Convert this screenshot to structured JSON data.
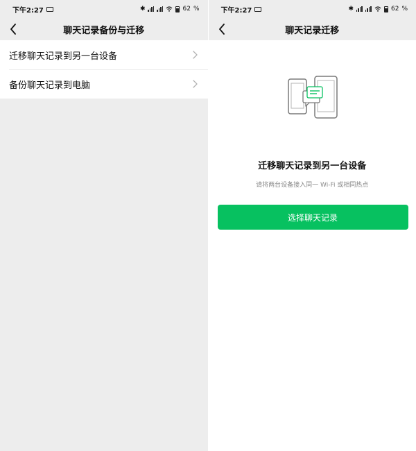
{
  "colors": {
    "brand_green": "#07c160",
    "background_gray": "#ededed",
    "text_primary": "#111111",
    "text_secondary": "#8a8a8a"
  },
  "status_bar": {
    "time": "下午2:27",
    "battery": "62",
    "battery_unit": "%",
    "icons": [
      "message-icon",
      "bluetooth-icon",
      "signal-icon",
      "signal-icon",
      "wifi-icon",
      "battery-icon"
    ]
  },
  "left_screen": {
    "nav": {
      "title": "聊天记录备份与迁移",
      "back_icon": "chevron-left-icon"
    },
    "items": [
      {
        "label": "迁移聊天记录到另一台设备",
        "icon": "chevron-right-icon"
      },
      {
        "label": "备份聊天记录到电脑",
        "icon": "chevron-right-icon"
      }
    ]
  },
  "right_screen": {
    "nav": {
      "title": "聊天记录迁移",
      "back_icon": "chevron-left-icon"
    },
    "illustration": "two-phones-transfer-icon",
    "heading": "迁移聊天记录到另一台设备",
    "subtitle": "请将两台设备接入同一 Wi-Fi 或相同热点",
    "button_label": "选择聊天记录"
  }
}
